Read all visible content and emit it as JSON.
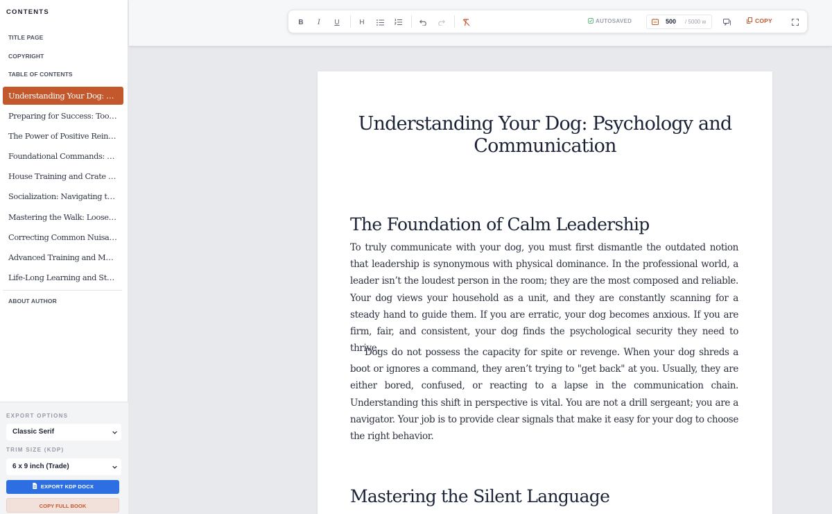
{
  "sidebar": {
    "title": "CONTENTS",
    "front_matter": [
      "TITLE PAGE",
      "COPYRIGHT",
      "TABLE OF CONTENTS"
    ],
    "chapters": [
      "Understanding Your Dog: Psychology and Communication",
      "Preparing for Success: Tools and Environment",
      "The Power of Positive Reinforcement",
      "Foundational Commands: The Basics",
      "House Training and Crate Basics",
      "Socialization: Navigating the Human World",
      "Mastering the Walk: Loose Leash Walking",
      "Correcting Common Nuisance Behaviors",
      "Advanced Training and Mental Stimulation",
      "Life-Long Learning and Strengthening the Bond"
    ],
    "active_chapter_index": 0,
    "back_matter": "ABOUT AUTHOR"
  },
  "export": {
    "options_label": "EXPORT OPTIONS",
    "style_value": "Classic Serif",
    "trim_label": "TRIM SIZE (KDP)",
    "trim_value": "6 x 9 inch (Trade)",
    "export_button": "EXPORT KDP DOCX",
    "copy_full_button": "COPY FULL BOOK"
  },
  "toolbar": {
    "bold": "B",
    "italic": "I",
    "underline": "U",
    "heading": "H",
    "autosaved": "AUTOSAVED",
    "word_count": "500",
    "word_total": "/ 5000 w",
    "copy": "COPY"
  },
  "colors": {
    "accent": "#c4582d",
    "primary_blue": "#2d6ee3"
  },
  "document": {
    "chapter_title": "Understanding Your Dog: Psychology and Communication",
    "section1_heading": "The Foundation of Calm Leadership",
    "section1_p1": "To truly communicate with your dog, you must first dismantle the outdated notion that leadership is synonymous with physical dominance. In the professional world, a leader isn’t the loudest person in the room; they are the most composed and reliable. Your dog views your household as a unit, and they are constantly scanning for a steady hand to guide them. If you are erratic, your dog becomes anxious. If you are firm, fair, and consistent, your dog finds the psychological security they need to thrive.",
    "section1_p2": "Dogs do not possess the capacity for spite or revenge. When your dog shreds a boot or ignores a command, they aren’t trying to \"get back\" at you. Usually, they are either bored, confused, or reacting to a lapse in the communication chain. Understanding this shift in perspective is vital. You are not a drill sergeant; you are a navigator. Your job is to provide clear signals that make it easy for your dog to choose the right behavior.",
    "section2_heading": "Mastering the Silent Language"
  }
}
